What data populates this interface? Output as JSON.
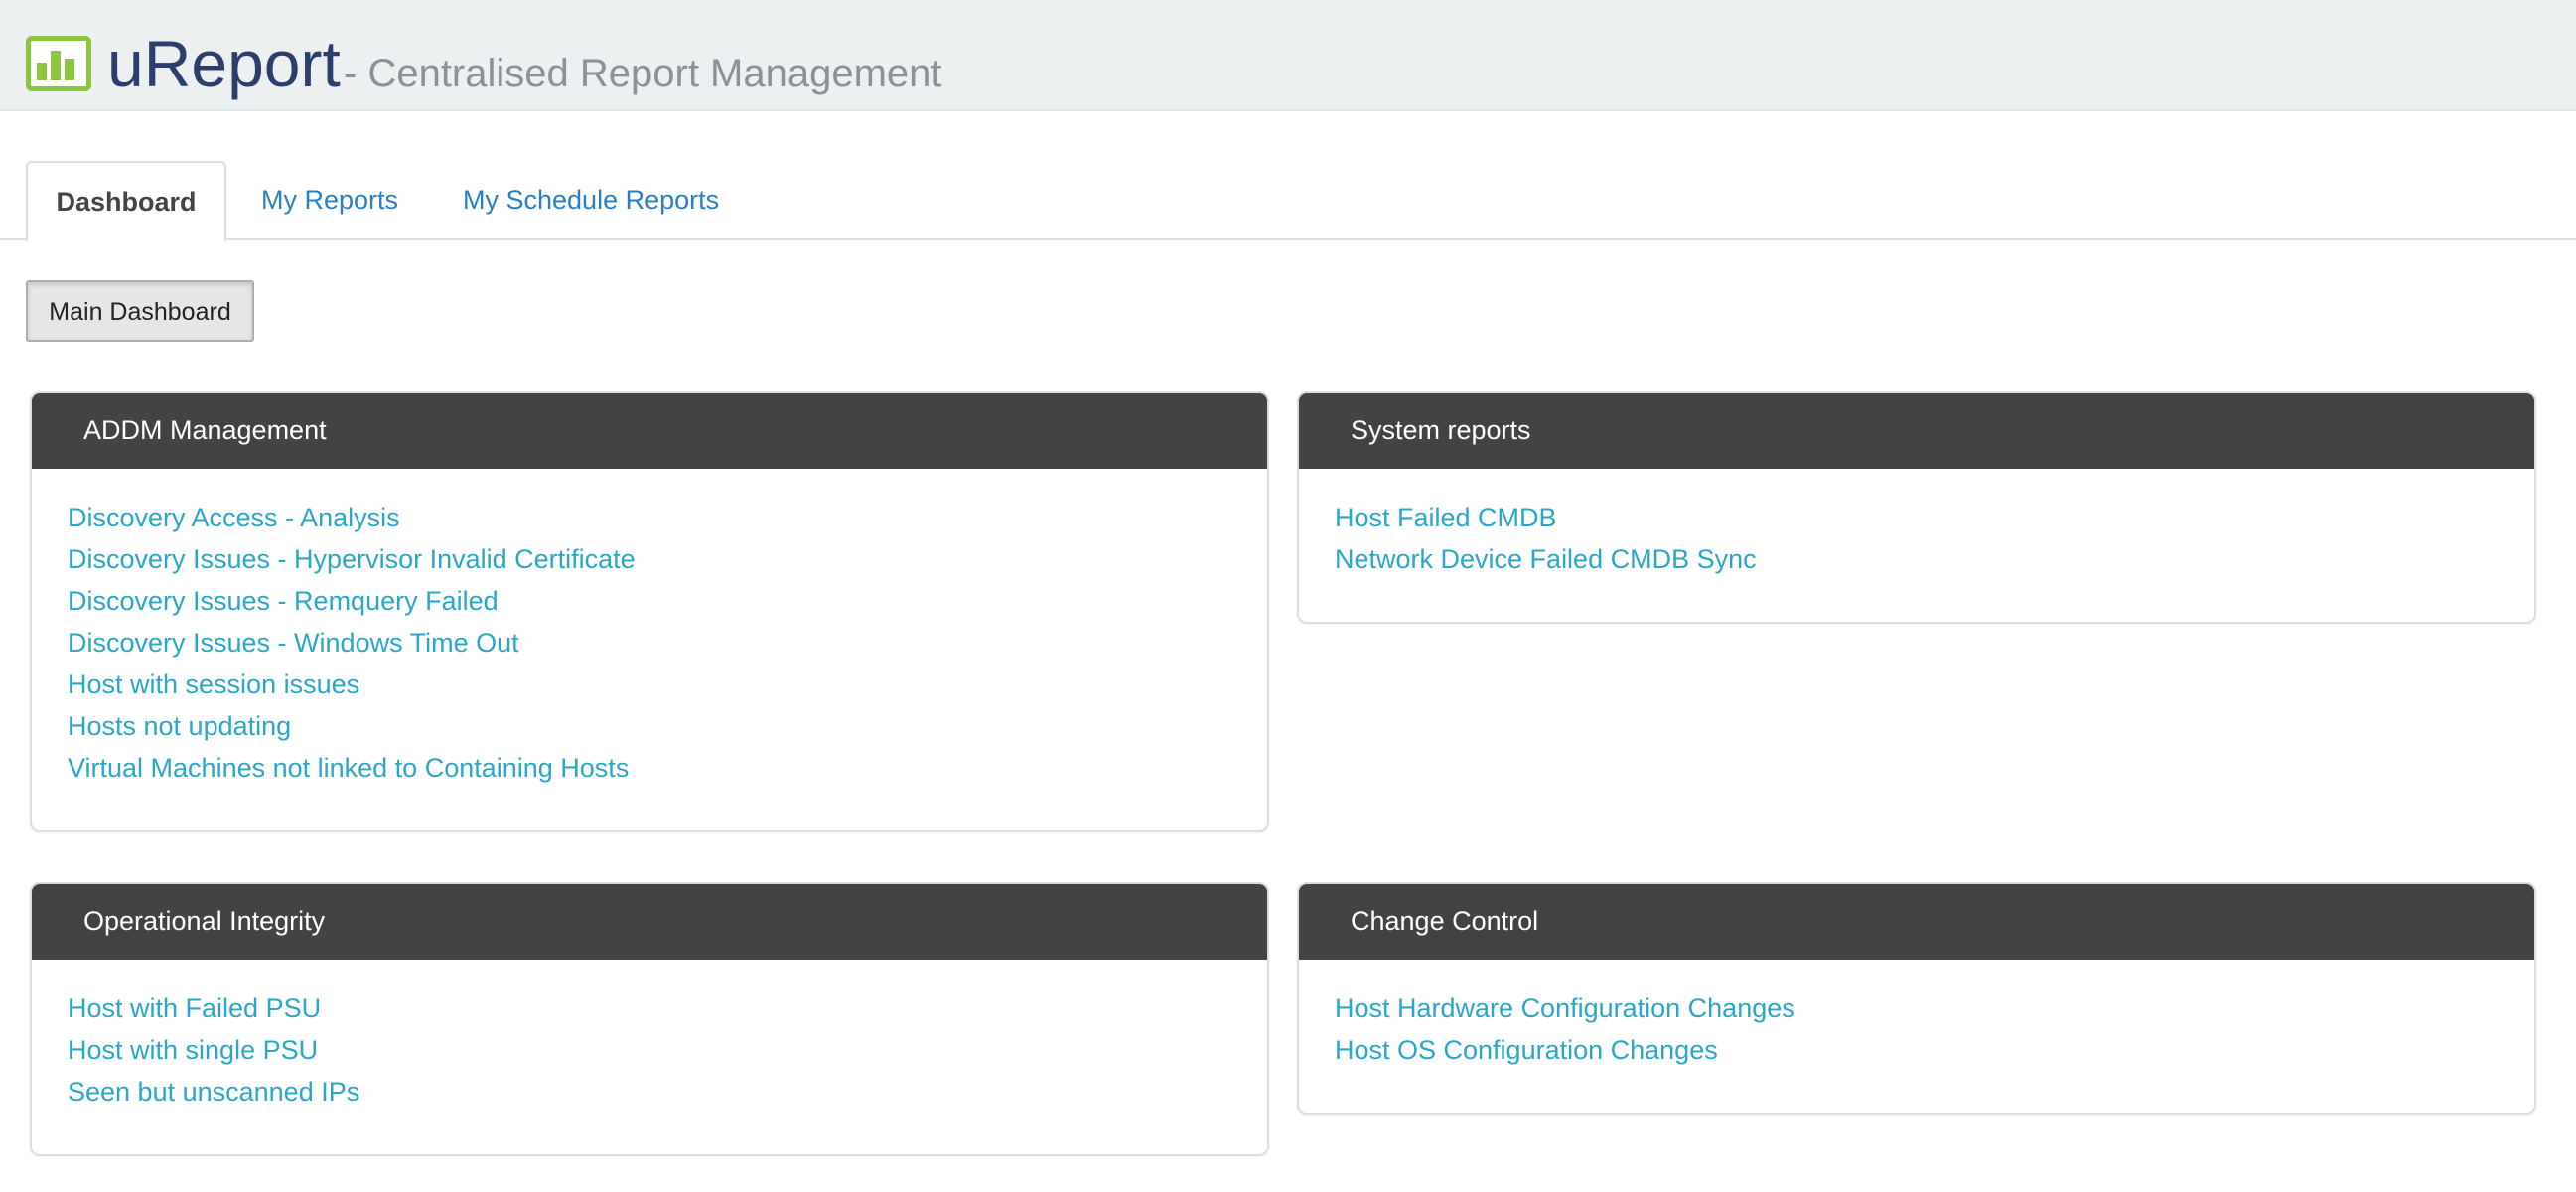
{
  "header": {
    "brand": "uReport",
    "tagline": "- Centralised Report Management",
    "logo_icon": "bar-chart-icon",
    "logo_color": "#8cc63f"
  },
  "tabs": [
    {
      "label": "Dashboard",
      "active": true
    },
    {
      "label": "My Reports",
      "active": false
    },
    {
      "label": "My Schedule Reports",
      "active": false
    }
  ],
  "toolbar": {
    "main_dashboard_label": "Main Dashboard"
  },
  "panels": {
    "addm": {
      "title": "ADDM Management",
      "links": [
        "Discovery Access - Analysis",
        "Discovery Issues - Hypervisor Invalid Certificate",
        "Discovery Issues - Remquery Failed",
        "Discovery Issues - Windows Time Out",
        "Host with session issues",
        "Hosts not updating",
        "Virtual Machines not linked to Containing Hosts"
      ]
    },
    "system": {
      "title": "System reports",
      "links": [
        "Host Failed CMDB",
        "Network Device Failed CMDB Sync"
      ]
    },
    "operational": {
      "title": "Operational Integrity",
      "links": [
        "Host with Failed PSU",
        "Host with single PSU",
        "Seen but unscanned IPs"
      ]
    },
    "change": {
      "title": "Change Control",
      "links": [
        "Host Hardware Configuration Changes",
        "Host OS Configuration Changes"
      ]
    }
  },
  "colors": {
    "header_bg": "#ecf0f1",
    "brand_text": "#2c3e6b",
    "panel_head_bg": "#434343",
    "link": "#2aa6c9",
    "tab_link": "#2a7fc4"
  }
}
